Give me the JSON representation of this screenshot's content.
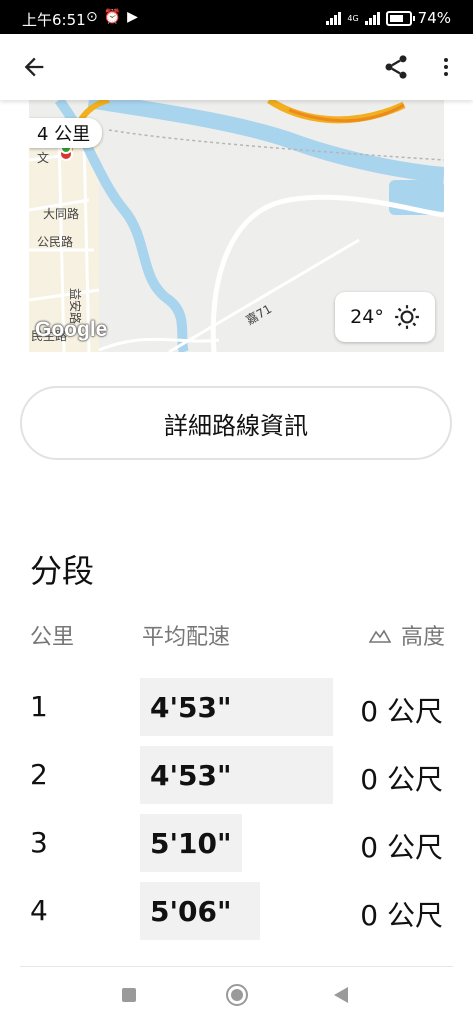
{
  "status_bar": {
    "time": "上午6:51",
    "network": "4G",
    "battery": "74%"
  },
  "app_bar": {
    "back_icon": "arrow-left-icon",
    "share_icon": "share-icon",
    "more_icon": "more-vert-icon"
  },
  "map": {
    "distance_chip": "4 公里",
    "road_labels": [
      "大同路",
      "公民路",
      "益安路",
      "民生路",
      "嘉71",
      "文"
    ],
    "weather": {
      "temp": "24°",
      "icon": "sun-icon"
    },
    "attribution": "Google"
  },
  "details_button": {
    "label": "詳細路線資訊"
  },
  "splits": {
    "title": "分段",
    "headers": {
      "km": "公里",
      "pace": "平均配速",
      "elevation": "高度"
    },
    "rows": [
      {
        "km": "1",
        "pace": "4'53\"",
        "elevation": "0 公尺",
        "bar_fraction": 0.95
      },
      {
        "km": "2",
        "pace": "4'53\"",
        "elevation": "0 公尺",
        "bar_fraction": 0.95
      },
      {
        "km": "3",
        "pace": "5'10\"",
        "elevation": "0 公尺",
        "bar_fraction": 0.5
      },
      {
        "km": "4",
        "pace": "5'06\"",
        "elevation": "0 公尺",
        "bar_fraction": 0.59
      }
    ]
  },
  "colors": {
    "route": "#f2b01e",
    "river": "#a8d4ee",
    "map_bg": "#eeeeec"
  }
}
